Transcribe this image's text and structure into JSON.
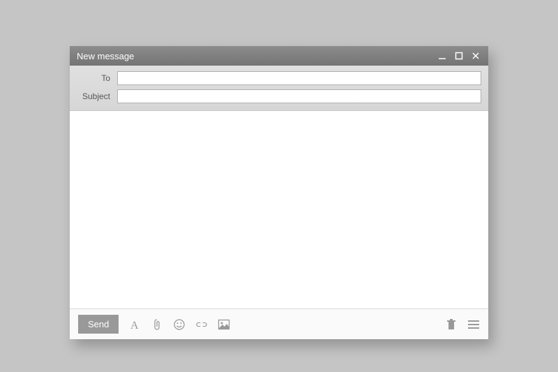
{
  "window": {
    "title": "New message"
  },
  "fields": {
    "to": {
      "label": "To",
      "value": ""
    },
    "subject": {
      "label": "Subject",
      "value": ""
    }
  },
  "body": {
    "value": ""
  },
  "toolbar": {
    "send_label": "Send"
  },
  "icons": {
    "minimize": "minimize-icon",
    "maximize": "maximize-icon",
    "close": "close-icon",
    "font": "font-icon",
    "attach": "attachment-icon",
    "emoji": "emoji-icon",
    "link": "link-icon",
    "image": "image-icon",
    "delete": "trash-icon",
    "menu": "menu-icon"
  }
}
